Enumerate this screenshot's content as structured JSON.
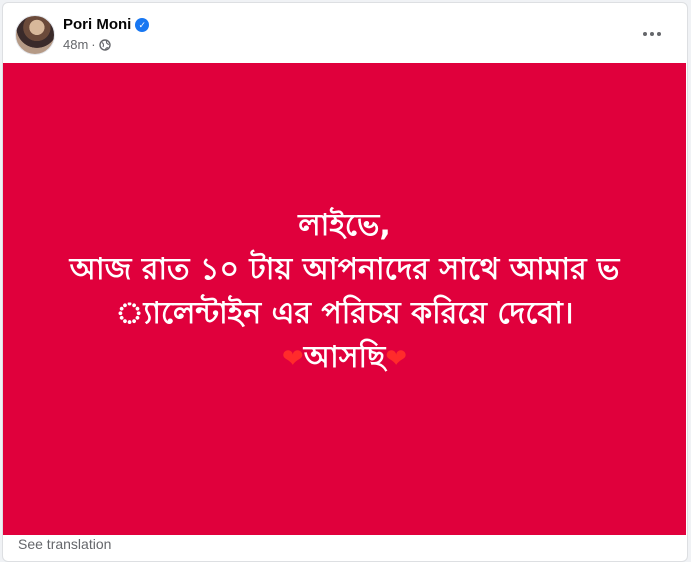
{
  "post": {
    "author": "Pori Moni",
    "verified_icon": "verified-badge-icon",
    "time": "48m",
    "separator": "·",
    "privacy_icon": "globe-icon",
    "more_icon": "more-options-icon"
  },
  "image": {
    "background": "#e0003c",
    "lines": [
      "লাইভে,",
      "আজ রাত ১০ টায় আপনাদের সাথে আমার ভ",
      "্যালেন্টাইন এর পরিচয় করিয়ে দেবো।",
      "আসছি"
    ],
    "heart_left": "❤",
    "heart_right": "❤"
  },
  "footer": {
    "see_translation": "See translation"
  },
  "colors": {
    "accent": "#1877f2",
    "secondary_text": "#65676b"
  }
}
